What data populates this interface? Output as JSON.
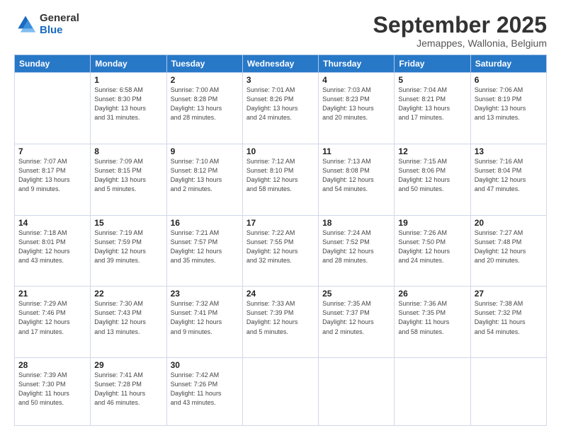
{
  "logo": {
    "general": "General",
    "blue": "Blue"
  },
  "header": {
    "title": "September 2025",
    "subtitle": "Jemappes, Wallonia, Belgium"
  },
  "weekdays": [
    "Sunday",
    "Monday",
    "Tuesday",
    "Wednesday",
    "Thursday",
    "Friday",
    "Saturday"
  ],
  "weeks": [
    [
      {
        "day": "",
        "info": ""
      },
      {
        "day": "1",
        "info": "Sunrise: 6:58 AM\nSunset: 8:30 PM\nDaylight: 13 hours\nand 31 minutes."
      },
      {
        "day": "2",
        "info": "Sunrise: 7:00 AM\nSunset: 8:28 PM\nDaylight: 13 hours\nand 28 minutes."
      },
      {
        "day": "3",
        "info": "Sunrise: 7:01 AM\nSunset: 8:26 PM\nDaylight: 13 hours\nand 24 minutes."
      },
      {
        "day": "4",
        "info": "Sunrise: 7:03 AM\nSunset: 8:23 PM\nDaylight: 13 hours\nand 20 minutes."
      },
      {
        "day": "5",
        "info": "Sunrise: 7:04 AM\nSunset: 8:21 PM\nDaylight: 13 hours\nand 17 minutes."
      },
      {
        "day": "6",
        "info": "Sunrise: 7:06 AM\nSunset: 8:19 PM\nDaylight: 13 hours\nand 13 minutes."
      }
    ],
    [
      {
        "day": "7",
        "info": "Sunrise: 7:07 AM\nSunset: 8:17 PM\nDaylight: 13 hours\nand 9 minutes."
      },
      {
        "day": "8",
        "info": "Sunrise: 7:09 AM\nSunset: 8:15 PM\nDaylight: 13 hours\nand 5 minutes."
      },
      {
        "day": "9",
        "info": "Sunrise: 7:10 AM\nSunset: 8:12 PM\nDaylight: 13 hours\nand 2 minutes."
      },
      {
        "day": "10",
        "info": "Sunrise: 7:12 AM\nSunset: 8:10 PM\nDaylight: 12 hours\nand 58 minutes."
      },
      {
        "day": "11",
        "info": "Sunrise: 7:13 AM\nSunset: 8:08 PM\nDaylight: 12 hours\nand 54 minutes."
      },
      {
        "day": "12",
        "info": "Sunrise: 7:15 AM\nSunset: 8:06 PM\nDaylight: 12 hours\nand 50 minutes."
      },
      {
        "day": "13",
        "info": "Sunrise: 7:16 AM\nSunset: 8:04 PM\nDaylight: 12 hours\nand 47 minutes."
      }
    ],
    [
      {
        "day": "14",
        "info": "Sunrise: 7:18 AM\nSunset: 8:01 PM\nDaylight: 12 hours\nand 43 minutes."
      },
      {
        "day": "15",
        "info": "Sunrise: 7:19 AM\nSunset: 7:59 PM\nDaylight: 12 hours\nand 39 minutes."
      },
      {
        "day": "16",
        "info": "Sunrise: 7:21 AM\nSunset: 7:57 PM\nDaylight: 12 hours\nand 35 minutes."
      },
      {
        "day": "17",
        "info": "Sunrise: 7:22 AM\nSunset: 7:55 PM\nDaylight: 12 hours\nand 32 minutes."
      },
      {
        "day": "18",
        "info": "Sunrise: 7:24 AM\nSunset: 7:52 PM\nDaylight: 12 hours\nand 28 minutes."
      },
      {
        "day": "19",
        "info": "Sunrise: 7:26 AM\nSunset: 7:50 PM\nDaylight: 12 hours\nand 24 minutes."
      },
      {
        "day": "20",
        "info": "Sunrise: 7:27 AM\nSunset: 7:48 PM\nDaylight: 12 hours\nand 20 minutes."
      }
    ],
    [
      {
        "day": "21",
        "info": "Sunrise: 7:29 AM\nSunset: 7:46 PM\nDaylight: 12 hours\nand 17 minutes."
      },
      {
        "day": "22",
        "info": "Sunrise: 7:30 AM\nSunset: 7:43 PM\nDaylight: 12 hours\nand 13 minutes."
      },
      {
        "day": "23",
        "info": "Sunrise: 7:32 AM\nSunset: 7:41 PM\nDaylight: 12 hours\nand 9 minutes."
      },
      {
        "day": "24",
        "info": "Sunrise: 7:33 AM\nSunset: 7:39 PM\nDaylight: 12 hours\nand 5 minutes."
      },
      {
        "day": "25",
        "info": "Sunrise: 7:35 AM\nSunset: 7:37 PM\nDaylight: 12 hours\nand 2 minutes."
      },
      {
        "day": "26",
        "info": "Sunrise: 7:36 AM\nSunset: 7:35 PM\nDaylight: 11 hours\nand 58 minutes."
      },
      {
        "day": "27",
        "info": "Sunrise: 7:38 AM\nSunset: 7:32 PM\nDaylight: 11 hours\nand 54 minutes."
      }
    ],
    [
      {
        "day": "28",
        "info": "Sunrise: 7:39 AM\nSunset: 7:30 PM\nDaylight: 11 hours\nand 50 minutes."
      },
      {
        "day": "29",
        "info": "Sunrise: 7:41 AM\nSunset: 7:28 PM\nDaylight: 11 hours\nand 46 minutes."
      },
      {
        "day": "30",
        "info": "Sunrise: 7:42 AM\nSunset: 7:26 PM\nDaylight: 11 hours\nand 43 minutes."
      },
      {
        "day": "",
        "info": ""
      },
      {
        "day": "",
        "info": ""
      },
      {
        "day": "",
        "info": ""
      },
      {
        "day": "",
        "info": ""
      }
    ]
  ]
}
